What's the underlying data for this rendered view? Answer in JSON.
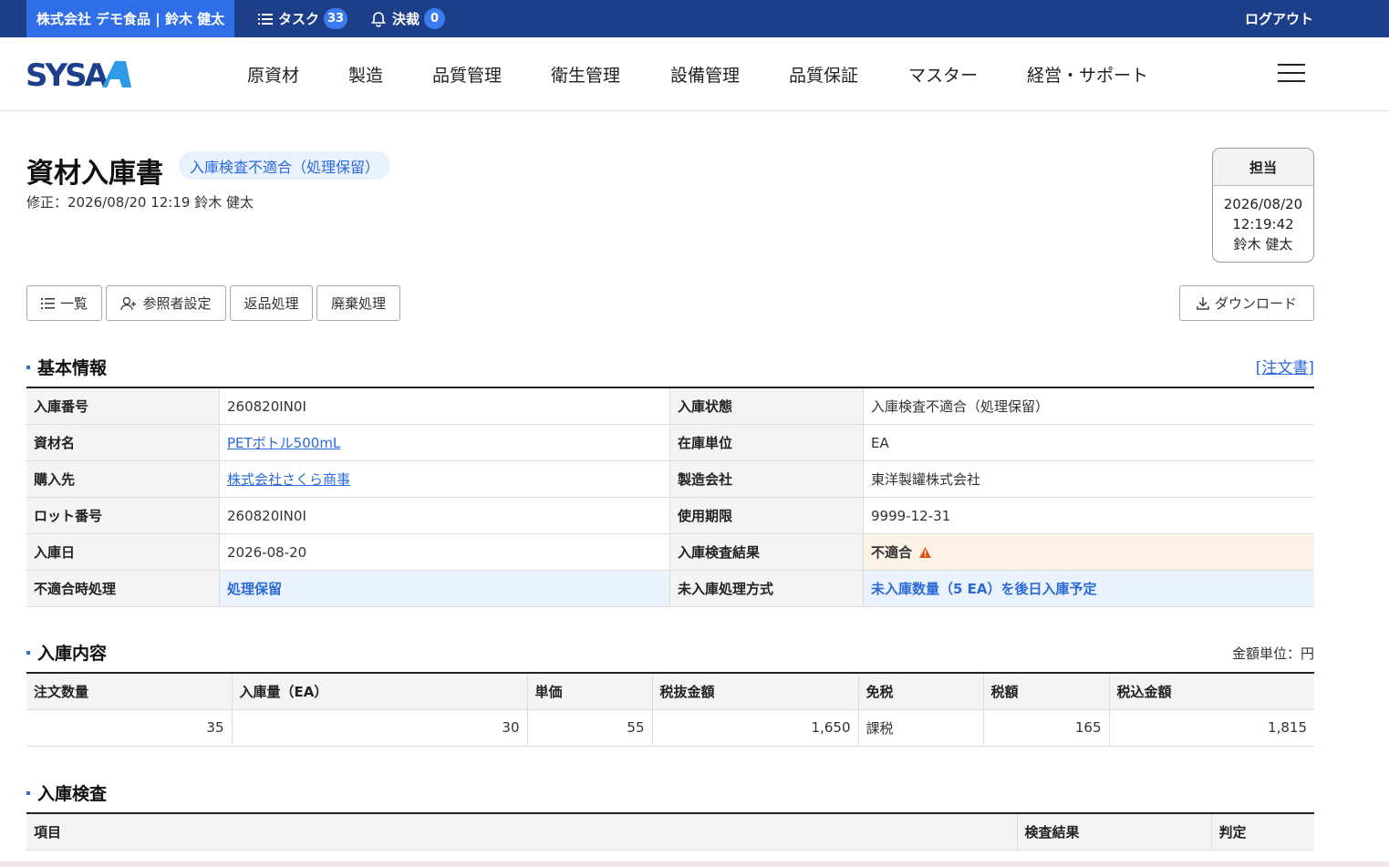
{
  "topbar": {
    "company_user": "株式会社 デモ食品 | 鈴木 健太",
    "tasks_label": "タスク",
    "tasks_count": "33",
    "approvals_label": "決裁",
    "approvals_count": "0",
    "logout": "ログアウト"
  },
  "nav": {
    "logo": "SYSA",
    "items": [
      "原資材",
      "製造",
      "品質管理",
      "衛生管理",
      "設備管理",
      "品質保証",
      "マスター",
      "経営・サポート"
    ]
  },
  "header": {
    "title": "資材入庫書",
    "status": "入庫検査不適合（処理保留）",
    "modified": "修正：2026/08/20 12:19 鈴木 健太"
  },
  "assignee": {
    "label": "担当",
    "date": "2026/08/20",
    "time": "12:19:42",
    "name": "鈴木 健太"
  },
  "actions": {
    "list": "一覧",
    "reference": "参照者設定",
    "return": "返品処理",
    "dispose": "廃棄処理",
    "download": "ダウンロード"
  },
  "basic": {
    "heading": "基本情報",
    "order_link": "[注文書]",
    "rows": [
      {
        "l1": "入庫番号",
        "v1": "260820IN0I",
        "l2": "入庫状態",
        "v2": "入庫検査不適合（処理保留）"
      },
      {
        "l1": "資材名",
        "v1": "PETボトル500mL",
        "l2": "在庫単位",
        "v2": "EA"
      },
      {
        "l1": "購入先",
        "v1": "株式会社さくら商事",
        "l2": "製造会社",
        "v2": "東洋製罐株式会社"
      },
      {
        "l1": "ロット番号",
        "v1": "260820IN0I",
        "l2": "使用期限",
        "v2": "9999-12-31"
      },
      {
        "l1": "入庫日",
        "v1": "2026-08-20",
        "l2": "入庫検査結果",
        "v2": "不適合"
      },
      {
        "l1": "不適合時処理",
        "v1": "処理保留",
        "l2": "未入庫処理方式",
        "v2": "未入庫数量（5 EA）を後日入庫予定"
      }
    ]
  },
  "contents": {
    "heading": "入庫内容",
    "unit_note": "金額単位：円",
    "headers": [
      "注文数量",
      "入庫量（EA）",
      "単価",
      "税抜金額",
      "免税",
      "税額",
      "税込金額"
    ],
    "row": [
      "35",
      "30",
      "55",
      "1,650",
      "課税",
      "165",
      "1,815"
    ]
  },
  "inspection": {
    "heading": "入庫検査",
    "headers": [
      "項目",
      "検査結果",
      "判定"
    ]
  },
  "colors": {
    "topbar": "#1d3f8a",
    "company": "#2f6ee6",
    "accent": "#2b6ad8",
    "warn": "#e0541c"
  }
}
